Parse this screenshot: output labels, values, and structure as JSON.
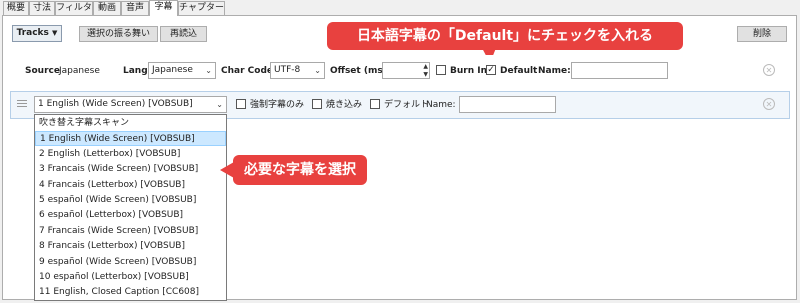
{
  "tabs": [
    "概要",
    "寸法",
    "フィルタ",
    "動画",
    "音声",
    "字幕",
    "チャプター"
  ],
  "active_tab": "字幕",
  "toolbar": {
    "tracks_label": "Tracks",
    "select_behavior_label": "選択の振る舞い",
    "reload_label": "再読込",
    "delete_label": "削除"
  },
  "callouts": {
    "default": "日本語字幕の「Default」にチェックを入れる",
    "select": "必要な字幕を選択"
  },
  "track1": {
    "source_label": "Source",
    "source_value": "Japanese",
    "lang_label": "Lang",
    "lang_value": "Japanese",
    "charcode_label": "Char Code",
    "charcode_value": "UTF-8",
    "offset_label": "Offset (ms)",
    "offset_value": "",
    "burnin_label": "Burn In",
    "burnin_checked": false,
    "default_label": "Default",
    "default_checked": true,
    "name_label": "Name:",
    "name_value": ""
  },
  "track2": {
    "selected_value": "1 English (Wide Screen) [VOBSUB]",
    "forced_only_label": "強制字幕のみ",
    "burnin_label": "焼き込み",
    "default_label": "デフォルト",
    "name_label": "Name:",
    "name_value": ""
  },
  "dropdown": {
    "selected_index": 1,
    "options": [
      "吹き替え字幕スキャン",
      "1 English (Wide Screen) [VOBSUB]",
      "2 English (Letterbox) [VOBSUB]",
      "3 Francais (Wide Screen) [VOBSUB]",
      "4 Francais (Letterbox) [VOBSUB]",
      "5 español (Wide Screen) [VOBSUB]",
      "6 español (Letterbox) [VOBSUB]",
      "7 Francais (Wide Screen) [VOBSUB]",
      "8 Francais (Letterbox) [VOBSUB]",
      "9 español (Wide Screen) [VOBSUB]",
      "10 español (Letterbox) [VOBSUB]",
      "11 English, Closed Caption [CC608]"
    ]
  },
  "colors": {
    "callout": "#e8413f",
    "selected_row": "#cce8ff",
    "track_row": "#f1f6fb"
  }
}
